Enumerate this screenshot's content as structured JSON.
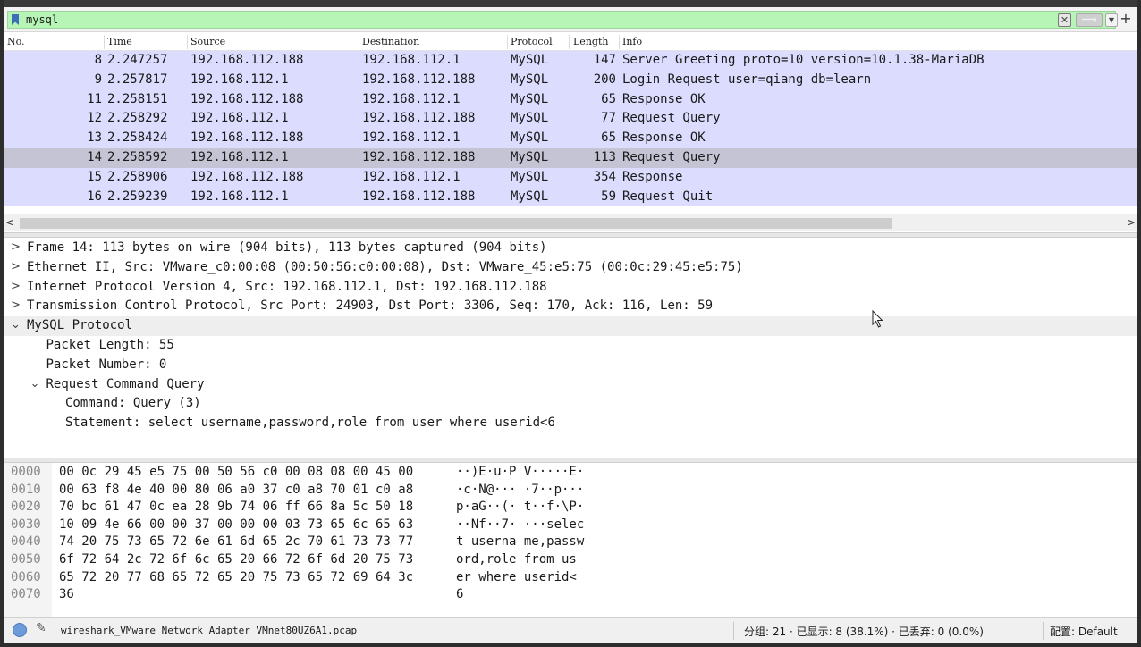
{
  "filter": {
    "value": "mysql",
    "clear_glyph": "✕",
    "apply_glyph": "⟹",
    "dropdown_glyph": "▼",
    "add_glyph": "+"
  },
  "columns": {
    "no": "No.",
    "time": "Time",
    "source": "Source",
    "destination": "Destination",
    "protocol": "Protocol",
    "length": "Length",
    "info": "Info"
  },
  "packets": [
    {
      "no": "8",
      "time": "2.247257",
      "source": "192.168.112.188",
      "destination": "192.168.112.1",
      "protocol": "MySQL",
      "length": "147",
      "info": "Server Greeting proto=10 version=10.1.38-MariaDB"
    },
    {
      "no": "9",
      "time": "2.257817",
      "source": "192.168.112.1",
      "destination": "192.168.112.188",
      "protocol": "MySQL",
      "length": "200",
      "info": "Login Request user=qiang db=learn"
    },
    {
      "no": "11",
      "time": "2.258151",
      "source": "192.168.112.188",
      "destination": "192.168.112.1",
      "protocol": "MySQL",
      "length": "65",
      "info": "Response OK"
    },
    {
      "no": "12",
      "time": "2.258292",
      "source": "192.168.112.1",
      "destination": "192.168.112.188",
      "protocol": "MySQL",
      "length": "77",
      "info": "Request Query"
    },
    {
      "no": "13",
      "time": "2.258424",
      "source": "192.168.112.188",
      "destination": "192.168.112.1",
      "protocol": "MySQL",
      "length": "65",
      "info": "Response OK"
    },
    {
      "no": "14",
      "time": "2.258592",
      "source": "192.168.112.1",
      "destination": "192.168.112.188",
      "protocol": "MySQL",
      "length": "113",
      "info": "Request Query"
    },
    {
      "no": "15",
      "time": "2.258906",
      "source": "192.168.112.188",
      "destination": "192.168.112.1",
      "protocol": "MySQL",
      "length": "354",
      "info": "Response"
    },
    {
      "no": "16",
      "time": "2.259239",
      "source": "192.168.112.1",
      "destination": "192.168.112.188",
      "protocol": "MySQL",
      "length": "59",
      "info": "Request Quit"
    }
  ],
  "selected_packet_index": 5,
  "scroll": {
    "left_glyph": "<",
    "right_glyph": ">"
  },
  "details": [
    {
      "indent": 0,
      "arrow": ">",
      "text": "Frame 14: 113 bytes on wire (904 bits), 113 bytes captured (904 bits)"
    },
    {
      "indent": 0,
      "arrow": ">",
      "text": "Ethernet II, Src: VMware_c0:00:08 (00:50:56:c0:00:08), Dst: VMware_45:e5:75 (00:0c:29:45:e5:75)"
    },
    {
      "indent": 0,
      "arrow": ">",
      "text": "Internet Protocol Version 4, Src: 192.168.112.1, Dst: 192.168.112.188"
    },
    {
      "indent": 0,
      "arrow": ">",
      "text": "Transmission Control Protocol, Src Port: 24903, Dst Port: 3306, Seq: 170, Ack: 116, Len: 59"
    },
    {
      "indent": 0,
      "arrow": "⌄",
      "text": "MySQL Protocol",
      "highlight": true
    },
    {
      "indent": 1,
      "arrow": "",
      "text": "Packet Length: 55"
    },
    {
      "indent": 1,
      "arrow": "",
      "text": "Packet Number: 0"
    },
    {
      "indent": 1,
      "arrow": "⌄",
      "text": "Request Command Query"
    },
    {
      "indent": 2,
      "arrow": "",
      "text": "Command: Query (3)"
    },
    {
      "indent": 2,
      "arrow": "",
      "text": "Statement: select username,password,role from user where userid<6"
    }
  ],
  "hex_rows": [
    {
      "offset": "0000",
      "bytes": "00 0c 29 45 e5 75 00 50  56 c0 00 08 08 00 45 00",
      "ascii": "··)E·u·P V·····E·"
    },
    {
      "offset": "0010",
      "bytes": "00 63 f8 4e 40 00 80 06  a0 37 c0 a8 70 01 c0 a8",
      "ascii": "·c·N@··· ·7··p···"
    },
    {
      "offset": "0020",
      "bytes": "70 bc 61 47 0c ea 28 9b  74 06 ff 66 8a 5c 50 18",
      "ascii": "p·aG··(· t··f·\\P·"
    },
    {
      "offset": "0030",
      "bytes": "10 09 4e 66 00 00 37 00  00 00 03 73 65 6c 65 63",
      "ascii": "··Nf··7· ···selec"
    },
    {
      "offset": "0040",
      "bytes": "74 20 75 73 65 72 6e 61  6d 65 2c 70 61 73 73 77",
      "ascii": "t userna me,passw"
    },
    {
      "offset": "0050",
      "bytes": "6f 72 64 2c 72 6f 6c 65  20 66 72 6f 6d 20 75 73",
      "ascii": "ord,role  from us"
    },
    {
      "offset": "0060",
      "bytes": "65 72 20 77 68 65 72 65  20 75 73 65 72 69 64 3c",
      "ascii": "er where  userid<"
    },
    {
      "offset": "0070",
      "bytes": "36",
      "ascii": "6"
    }
  ],
  "status": {
    "edit_glyph": "✎",
    "file": "wireshark_VMware Network Adapter VMnet80UZ6A1.pcap",
    "stats": "分组: 21 · 已显示: 8 (38.1%) · 已丢弃: 0 (0.0%)",
    "profile": "配置: Default"
  },
  "colors": {
    "filter_valid": "#b6f5b6",
    "row_mysql": "#dcdcff",
    "row_selected": "#c4c4d4"
  }
}
